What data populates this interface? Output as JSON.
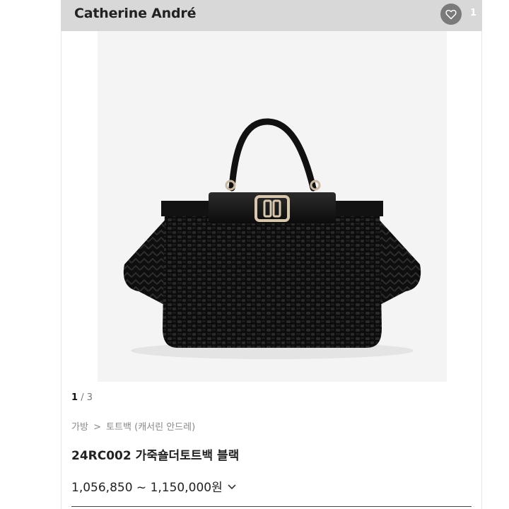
{
  "header": {
    "brand": "Catherine André",
    "like_count": "1",
    "heart_icon": "heart-outline-icon"
  },
  "gallery": {
    "current": "1",
    "separator": "/",
    "total": "3"
  },
  "breadcrumb": {
    "level1": "가방",
    "separator": ">",
    "level2": "토트백 (캐서린 안드레)"
  },
  "product": {
    "title": "24RC002 가죽숄더토트백 블랙",
    "price": "1,056,850 ~ 1,150,000원",
    "price_toggle_icon": "chevron-down-icon"
  },
  "colors": {
    "header_bg": "#d8d8d8",
    "heart_bg": "#7a7a7a"
  }
}
